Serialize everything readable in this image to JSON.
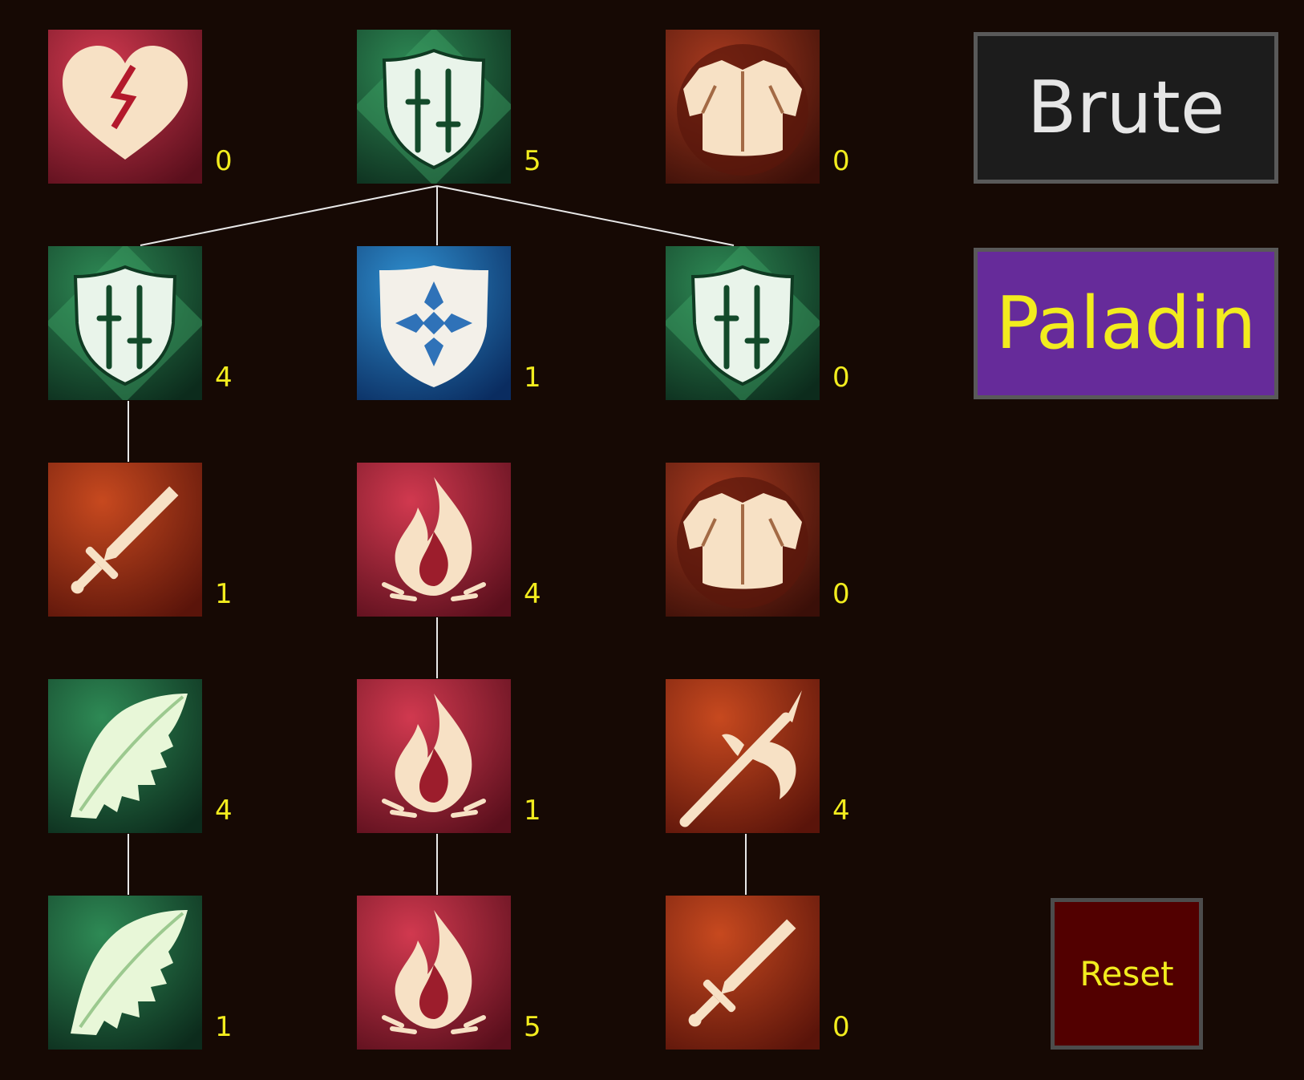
{
  "colors": {
    "background": "#160904",
    "rank_text": "#f2ec1e",
    "connector": "#e8e8e8",
    "brute_bg": "#1c1c1c",
    "paladin_bg": "#662b9a",
    "reset_bg": "#520000"
  },
  "talents": [
    {
      "icon": "broken-heart-icon",
      "theme": "crimson",
      "rank": "0"
    },
    {
      "icon": "crossed-swords-shield-icon",
      "theme": "green",
      "rank": "5"
    },
    {
      "icon": "chest-armor-icon",
      "theme": "rust",
      "rank": "0"
    },
    {
      "icon": "crossed-swords-shield-icon",
      "theme": "green",
      "rank": "4"
    },
    {
      "icon": "holy-cross-shield-icon",
      "theme": "blue",
      "rank": "1"
    },
    {
      "icon": "crossed-swords-shield-icon",
      "theme": "green",
      "rank": "0"
    },
    {
      "icon": "sword-icon",
      "theme": "orange",
      "rank": "1"
    },
    {
      "icon": "flame-icon",
      "theme": "crimson",
      "rank": "4"
    },
    {
      "icon": "chest-armor-icon",
      "theme": "rust",
      "rank": "0"
    },
    {
      "icon": "leaf-icon",
      "theme": "green",
      "rank": "4"
    },
    {
      "icon": "flame-icon",
      "theme": "crimson",
      "rank": "1"
    },
    {
      "icon": "halberd-axe-icon",
      "theme": "orange",
      "rank": "4"
    },
    {
      "icon": "leaf-icon",
      "theme": "green",
      "rank": "1"
    },
    {
      "icon": "flame-icon",
      "theme": "crimson",
      "rank": "5"
    },
    {
      "icon": "sword-icon",
      "theme": "orange",
      "rank": "0"
    }
  ],
  "classes": {
    "brute": "Brute",
    "paladin": "Paladin",
    "selected": "Paladin"
  },
  "reset_label": "Reset"
}
